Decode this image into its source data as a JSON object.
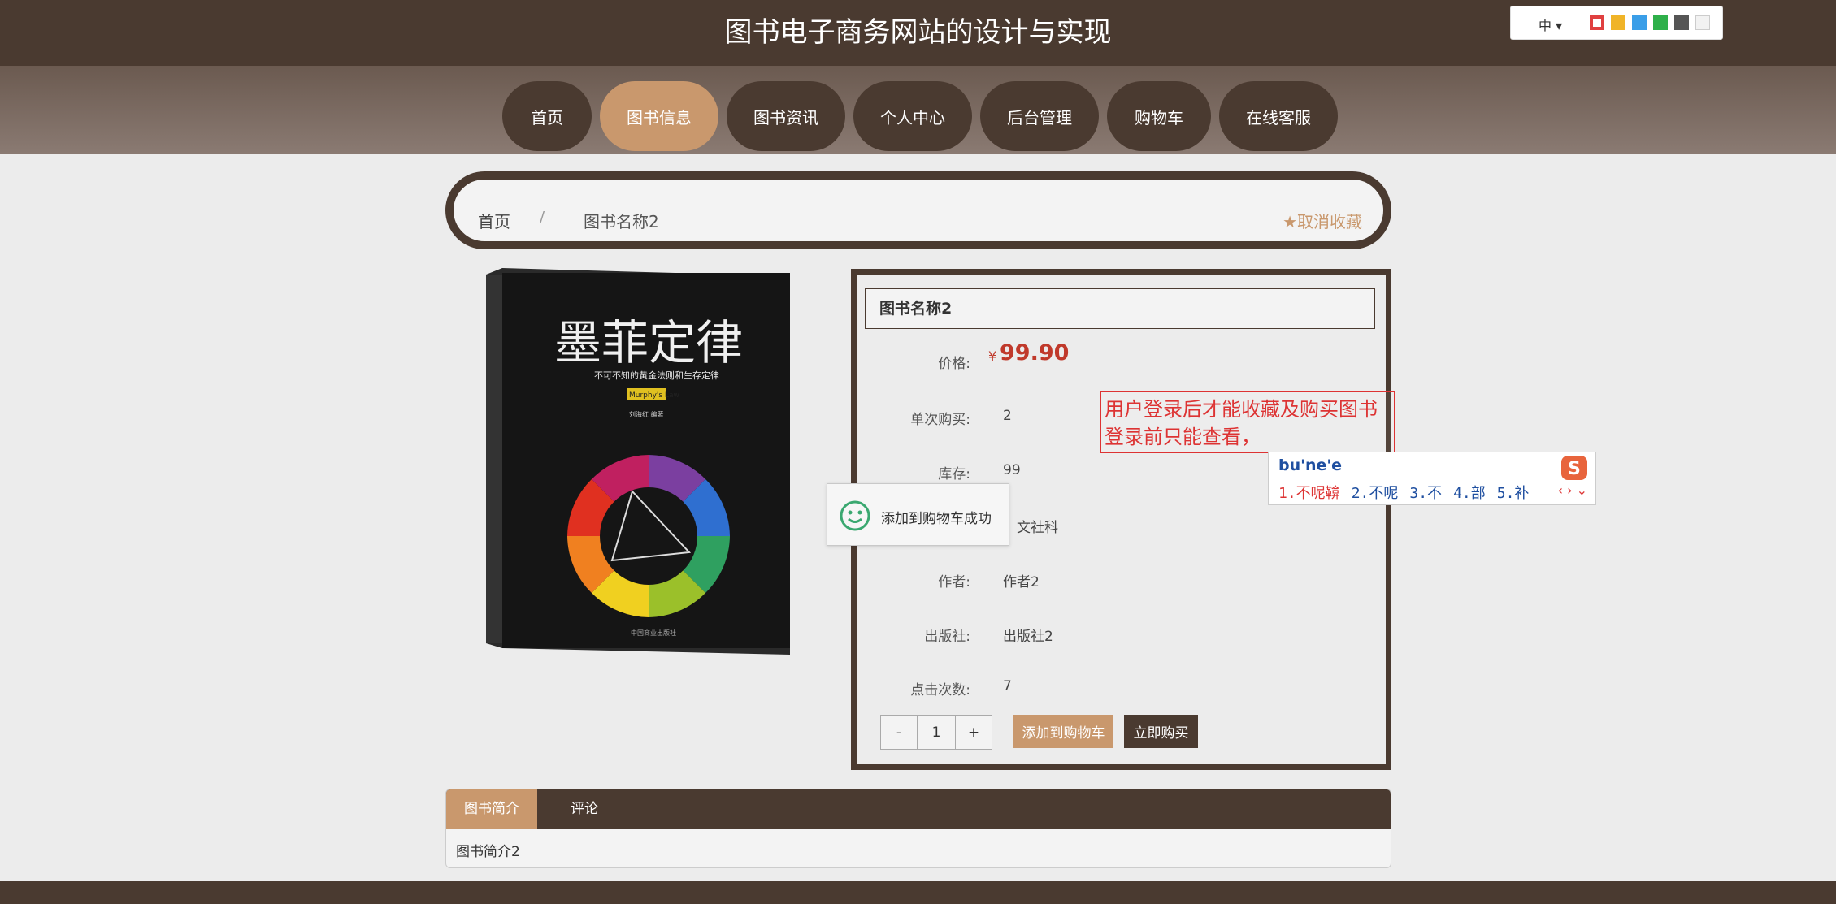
{
  "site": {
    "title": "图书电子商务网站的设计与实现"
  },
  "nav": {
    "items": [
      {
        "label": "首页",
        "active": false
      },
      {
        "label": "图书信息",
        "active": true
      },
      {
        "label": "图书资讯",
        "active": false
      },
      {
        "label": "个人中心",
        "active": false
      },
      {
        "label": "后台管理",
        "active": false
      },
      {
        "label": "购物车",
        "active": false
      },
      {
        "label": "在线客服",
        "active": false
      }
    ]
  },
  "toolbar": {
    "lang_label": "中",
    "swatches": [
      "#e04040",
      "#f0b428",
      "#3a9ee8",
      "#2eb04a",
      "#555555",
      "#f2f2f2"
    ]
  },
  "breadcrumb": {
    "home": "首页",
    "separator": "/",
    "current": "图书名称2",
    "favorite": "取消收藏"
  },
  "cover": {
    "title": "墨菲定律",
    "subtitle": "不可不知的黄金法则和生存定律",
    "badge": "Murphy's Law",
    "author_line": "刘海红 编著",
    "publisher": "中国商业出版社"
  },
  "detail": {
    "title": "图书名称2",
    "price_symbol": "¥",
    "price": "99.90",
    "fields": [
      {
        "label": "价格:",
        "value": ""
      },
      {
        "label": "单次购买:",
        "value": "2"
      },
      {
        "label": "库存:",
        "value": "99"
      },
      {
        "label": "",
        "value": "文社科"
      },
      {
        "label": "作者:",
        "value": "作者2"
      },
      {
        "label": "出版社:",
        "value": "出版社2"
      },
      {
        "label": "点击次数:",
        "value": "7"
      }
    ],
    "stepper": {
      "minus": "-",
      "value": "1",
      "plus": "+"
    },
    "add_to_cart": "添加到购物车",
    "buy_now": "立即购买"
  },
  "toast": {
    "text": "添加到购物车成功"
  },
  "note": {
    "line1": "用户登录后才能收藏及购买图书",
    "line2": "登录前只能查看，"
  },
  "ime": {
    "input": "bu'ne'e",
    "candidates": [
      "1.不呢鞥",
      "2.不呢",
      "3.不",
      "4.部",
      "5.补"
    ],
    "nav": "‹ › ⌄"
  },
  "tabs": {
    "items": [
      {
        "label": "图书简介",
        "active": true
      },
      {
        "label": "评论",
        "active": false
      }
    ],
    "content": "图书简介2"
  }
}
